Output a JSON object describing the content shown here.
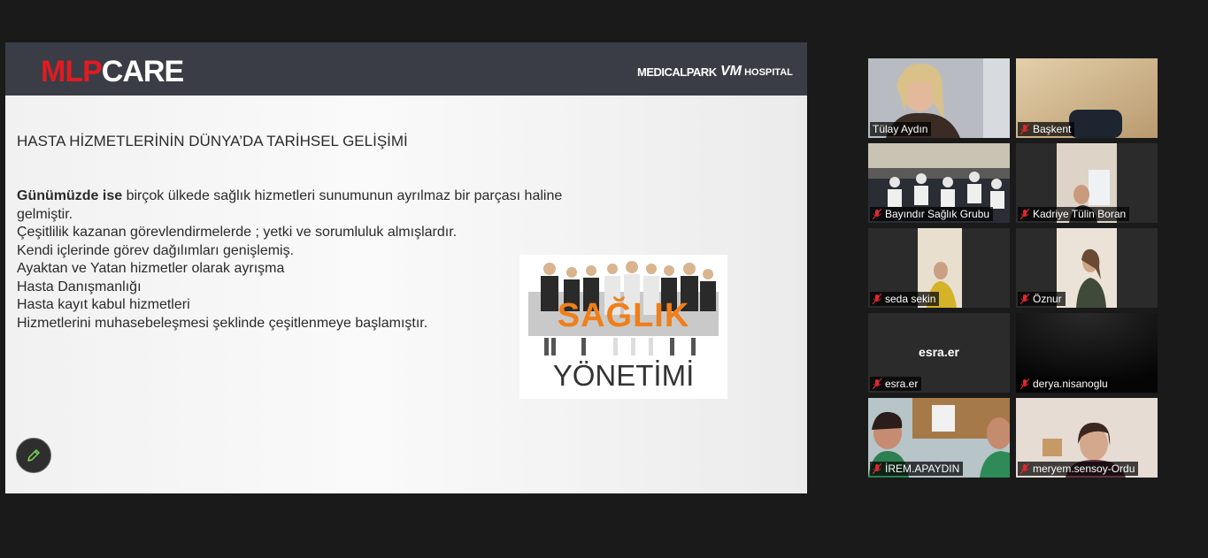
{
  "slide": {
    "logo": {
      "red": "MLP",
      "white": "CARE"
    },
    "partner_logos": {
      "medicalpark": "MEDICALPARK",
      "vm_mark": "VM",
      "vm_text": "HOSPITAL"
    },
    "title": "HASTA HİZMETLERİNİN DÜNYA’DA TARİHSEL GELİŞİMİ",
    "lead_bold": "Günümüzde ise",
    "lead_rest": "  birçok ülkede sağlık hizmetleri sunumunun ayrılmaz bir parçası haline gelmiştir.",
    "lines": [
      "Çeşitlilik kazanan görevlendirmelerde ; yetki ve sorumluluk almışlardır.",
      "Kendi içlerinde görev dağılımları genişlemiş.",
      "Ayaktan ve Yatan hizmetler olarak ayrışma",
      "Hasta Danışmanlığı",
      "Hasta kayıt kabul hizmetleri",
      "Hizmetlerini muhasebeleşmesi şeklinde çeşitlenmeye başlamıştır."
    ],
    "image_word1": "SAĞLIK",
    "image_word2": "YÖNETİMİ"
  },
  "annotate": {
    "icon": "pencil-icon"
  },
  "participants": [
    {
      "name": "Tülay Aydın",
      "muted": false,
      "active": true
    },
    {
      "name": "Başkent",
      "muted": true
    },
    {
      "name": "Bayındır Sağlık Grubu",
      "muted": true
    },
    {
      "name": "Kadriye Tülin Boran",
      "muted": true
    },
    {
      "name": "seda sekin",
      "muted": true
    },
    {
      "name": "Öznur",
      "muted": true
    },
    {
      "name": "esra.er",
      "muted": true,
      "placeholder": "esra.er"
    },
    {
      "name": "derya.nisanoglu",
      "muted": true
    },
    {
      "name": "İREM.APAYDIN",
      "muted": true
    },
    {
      "name": "meryem.sensoy-Ordu",
      "muted": true
    }
  ],
  "colors": {
    "active_border": "#b3d335",
    "brand_red": "#e11b22",
    "accent_orange": "#f07f1a",
    "muted_mic": "#e0282e"
  }
}
